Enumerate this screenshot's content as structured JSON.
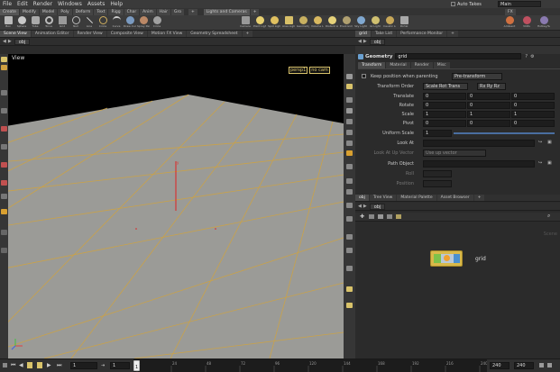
{
  "menubar": {
    "items": [
      "File",
      "Edit",
      "Render",
      "Windows",
      "Assets",
      "Help"
    ],
    "autotakes_label": "Auto Takes",
    "desktop": "Main"
  },
  "shelf": {
    "tabs_left": [
      "Create",
      "Modify",
      "Model",
      "Poly",
      "Deform",
      "Text",
      "Rigg",
      "Char",
      "Anim",
      "Hair",
      "Gro"
    ],
    "tabs_right": [
      "Lights and Cameras"
    ],
    "tools_left": [
      "Box",
      "Sphere",
      "Tube",
      "Torus",
      "Grid",
      "Null",
      "Line",
      "Circle",
      "Curve",
      "Draw Curve",
      "Spray Paint",
      "Circle"
    ],
    "tools_right": [
      "Camera",
      "Point Light",
      "Spot Light",
      "Area Light",
      "Geometry L",
      "Volume Light",
      "Distant Light",
      "Environment",
      "Sky Light",
      "GI Light",
      "Caustic Light",
      "Portal"
    ],
    "tools_far": [
      "Ambient",
      "VOPs",
      "Hotkey/Scale"
    ],
    "tab_fx": "FX"
  },
  "left_pane": {
    "tabs": [
      "Scene View",
      "Animation Editor",
      "Render View",
      "Composite View",
      "Motion FX View",
      "Geometry Spreadsheet"
    ],
    "path": "obj",
    "view_label": "View",
    "persp_button": "persp1",
    "cam_button": "no cam"
  },
  "param_pane": {
    "tabs": [
      "grid",
      "Take List",
      "Performance Monitor"
    ],
    "path": "obj",
    "node_type": "Geometry",
    "node_name": "grid",
    "subtabs": [
      "Transform",
      "Material",
      "Render",
      "Misc"
    ],
    "keep_position_label": "Keep position when parenting",
    "keep_position_value": "Pre-transform",
    "transform_order_label": "Transform Order",
    "transform_order_value": "Scale Rot Trans",
    "rotate_order_value": "Rx Ry Rz",
    "translate": {
      "label": "Translate",
      "values": [
        "0",
        "0",
        "0"
      ]
    },
    "rotate": {
      "label": "Rotate",
      "values": [
        "0",
        "0",
        "0"
      ]
    },
    "scale": {
      "label": "Scale",
      "values": [
        "1",
        "1",
        "1"
      ]
    },
    "pivot": {
      "label": "Pivot",
      "values": [
        "0",
        "0",
        "0"
      ]
    },
    "uniform_scale": {
      "label": "Uniform Scale",
      "value": "1"
    },
    "look_at_label": "Look At",
    "look_at_up_label": "Look At Up Vector",
    "look_at_up_value": "Use up vector",
    "path_object_label": "Path Object",
    "roll_label": "Roll",
    "position_label": "Position"
  },
  "network_pane": {
    "tabs": [
      "obj",
      "Tree View",
      "Material Palette",
      "Asset Browser"
    ],
    "path": "obj",
    "node_label": "grid",
    "context_label": "Scene"
  },
  "timeline": {
    "start_frame": "1",
    "step": "1",
    "ticks": [
      "1",
      "24",
      "48",
      "72",
      "96",
      "120",
      "144",
      "168",
      "192",
      "216",
      "240"
    ],
    "end_value": "240",
    "end_value2": "240"
  },
  "colors": {
    "accent_yellow": "#d9c36a",
    "grid_lines": "#c9a24a",
    "grid_floor": "#9a9a96",
    "node_green": "#7ec24a",
    "node_blue": "#4a90d0"
  }
}
